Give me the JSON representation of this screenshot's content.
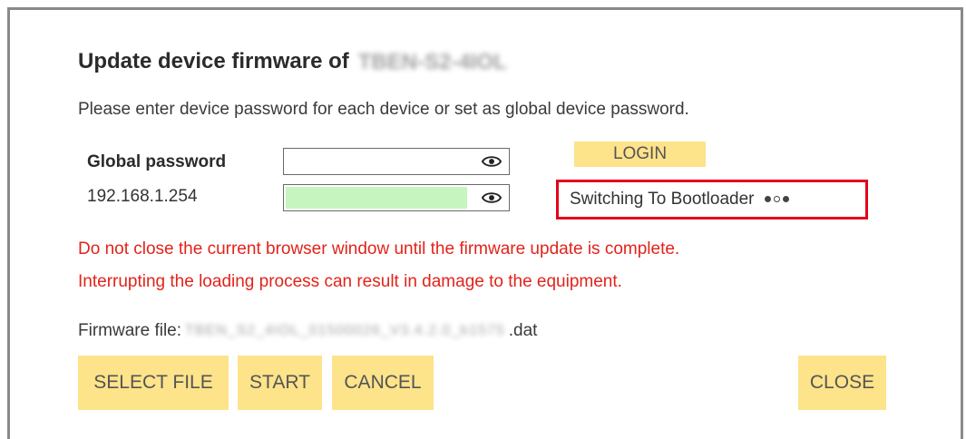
{
  "dialog": {
    "title": "Update device firmware of",
    "device_name": "TBEN-S2-4IOL",
    "instructions": "Please enter device password for each device or set as global device password."
  },
  "passwords": {
    "global_label": "Global password",
    "device_ip": "192.168.1.254",
    "login_label": "LOGIN"
  },
  "status": {
    "text": "Switching To Bootloader",
    "color": "#e2001a"
  },
  "warnings": {
    "line1": "Do not close the current browser window until the firmware update is complete.",
    "line2": "Interrupting the loading process can result in damage to the equipment.",
    "color": "#e2231a"
  },
  "firmware": {
    "label": "Firmware file:",
    "filename": "TBEN_S2_4IOL_01500026_V3.4.2.0_b1575",
    "extension": ".dat"
  },
  "buttons": {
    "select_file": "SELECT FILE",
    "start": "START",
    "cancel": "CANCEL",
    "close": "CLOSE",
    "color": "#fde38a"
  },
  "icons": {
    "eye": "eye-icon"
  }
}
